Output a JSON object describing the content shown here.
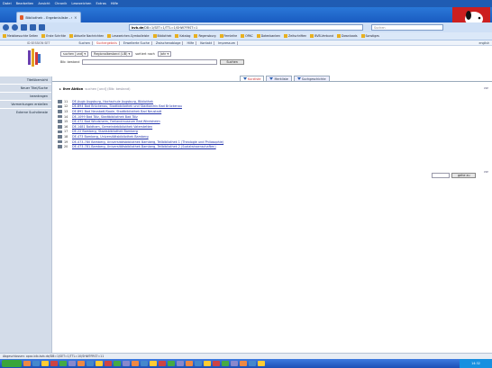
{
  "browser": {
    "menu": [
      "Datei",
      "Bearbeiten",
      "Ansicht",
      "Chronik",
      "Lesezeichen",
      "Extras",
      "Hilfe"
    ],
    "tab_title": "Bibliothek - Ergebnisliste - GVK",
    "url_domain": "bvb.de",
    "url_rest": "/DB=1/SET=1/TTL=1/SHW?FRST=1",
    "search_placeholder": "Suchen",
    "bookmarks": [
      "Meistbesuchte Seiten",
      "Erste Schritte",
      "Aktuelle Nachrichten",
      "Lesezeichen-Symbolleiste",
      "Bibliothek",
      "Katalog",
      "Regensburg",
      "Fernleihe",
      "OPAC",
      "Datenbanken",
      "Zeitschriften",
      "BVB-Verbund",
      "Downloads",
      "Sonstiges"
    ]
  },
  "opac": {
    "debug": "ID SESSION SET",
    "tabs": [
      "Suchen",
      "Suchergebnis",
      "Erweiterte Suche",
      "Zwischenablage",
      "Hilfe",
      "Kontakt",
      "Impressum"
    ],
    "active_tab_index": 1,
    "lang": "english",
    "form": {
      "field1": "suchen [und]",
      "field2": "Regionalbestand (LIB)",
      "sort_label": "sortiert nach",
      "sort_value": "Jahr",
      "scope_label": "Bib: bestand",
      "search_button": "Suchen"
    }
  },
  "sidebar": {
    "items": [
      "Titelübersicht",
      "Neuer Titel/Suche",
      "beantragen",
      "Vormerkungen erstellen",
      "Externe Suchdienste"
    ]
  },
  "view_tabs": {
    "items": [
      "Kurzliste",
      "Merkliste",
      "Suchgeschichte"
    ],
    "active_index": 0
  },
  "results": {
    "heading": "Ihre Aktion",
    "query": "suchen [und] (Bib: bestand)",
    "nav": "vor",
    "goto_label": "gehe zu",
    "items": [
      {
        "n": "11",
        "text": "DE-Augb Augsburg, Hochschule Augsburg, Bibliothek"
      },
      {
        "n": "12",
        "text": "DE-B94 Bad Brückenau, Stadtbibliothek und Stadtarchiv Bad Brückenau"
      },
      {
        "n": "13",
        "text": "DE-B92 Bad Neustadt/Saale, Stadtbibliothek Bad Neustadt"
      },
      {
        "n": "14",
        "text": "DE-1099 Bad Tölz, Stadtbibliothek Bad Tölz"
      },
      {
        "n": "15",
        "text": "DE-472 Bad Windsheim, Freilandmuseum Bad Windsheim"
      },
      {
        "n": "16",
        "text": "DE-1481 Baldham, Gemeindebibliothek Vaterstetten"
      },
      {
        "n": "17",
        "text": "DE-22 Bamberg, Staatsbibliothek Bamberg"
      },
      {
        "n": "18",
        "text": "DE-473 Bamberg, Universitätsbibliothek Bamberg"
      },
      {
        "n": "19",
        "text": "DE-473-780 Bamberg, Universitätsbibliothek Bamberg, Teilbibliothek 1 (Theologie und Philosophie)"
      },
      {
        "n": "20",
        "text": "DE-473-781 Bamberg, Universitätsbibliothek Bamberg, Teilbibliothek 2 (Sozialwissenschaften)"
      }
    ]
  },
  "status": "Abgeschlossen: opac.bib-bvb.de/DB=1/SET=1/TTL=10/SHW?FRST=11",
  "taskbar": {
    "clock": "14:32"
  }
}
